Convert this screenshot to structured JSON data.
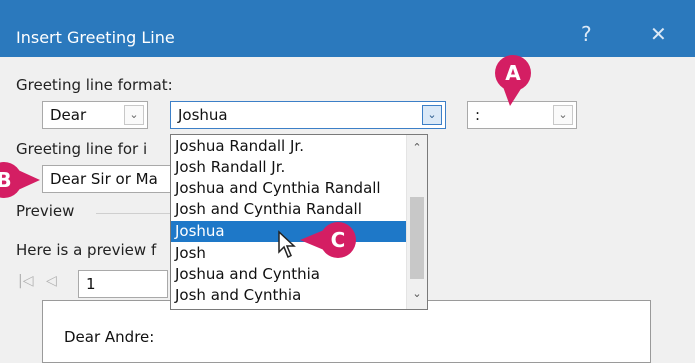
{
  "window": {
    "title": "Insert Greeting Line",
    "help": "?",
    "close": "✕"
  },
  "greeting_format": {
    "label": "Greeting line format:",
    "salutation": "Dear",
    "name_format": "Joshua",
    "punctuation": ":"
  },
  "invalid_recipients": {
    "label": "Greeting line for i",
    "value": "Dear Sir or Ma"
  },
  "preview": {
    "section_label": "Preview",
    "here_label": "Here is a preview f",
    "record_number": "1",
    "preview_text": "Dear Andre:"
  },
  "dropdown": {
    "items": [
      "Joshua Randall Jr.",
      "Josh Randall Jr.",
      "Joshua and Cynthia Randall",
      "Josh and Cynthia Randall",
      "Joshua",
      "Josh",
      "Joshua and Cynthia",
      "Josh and Cynthia"
    ],
    "selected_index": 4
  },
  "callouts": {
    "a": "A",
    "b": "B",
    "c": "C"
  },
  "colors": {
    "titlebar": "#2b79bd",
    "selection": "#1e78c8",
    "callout": "#d41e63"
  }
}
